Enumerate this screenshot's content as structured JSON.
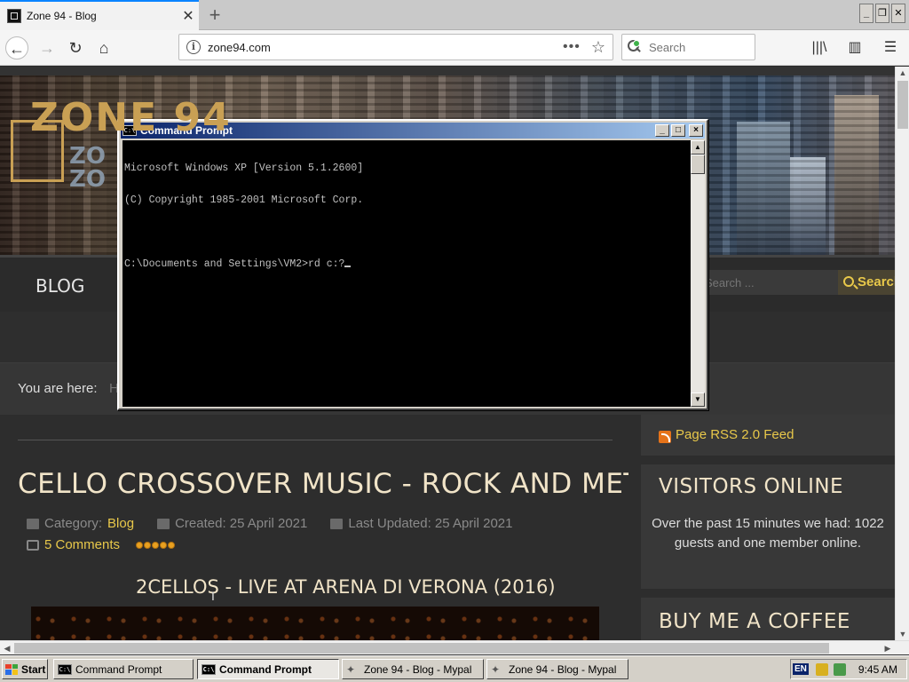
{
  "browser": {
    "tab_title": "Zone 94 - Blog",
    "tab_close": "✕",
    "new_tab": "+",
    "url": "zone94.com",
    "url_actions": "•••",
    "search_placeholder": "Search",
    "window_min": "_",
    "window_restore": "❐",
    "window_close": "✕"
  },
  "site": {
    "logo_text": "ZONE 94",
    "logo_ghost_1": "ZO",
    "logo_ghost_2": "ZO",
    "nav_blog": "BLOG",
    "search_placeholder": "Search ...",
    "search_button": "Search",
    "breadcrumb_label": "You are here:",
    "breadcrumb_home": "H"
  },
  "article": {
    "title": "CELLO CROSSOVER MUSIC - ROCK AND METAL",
    "category_label": "Category:",
    "category": "Blog",
    "created": "Created: 25 April 2021",
    "updated": "Last Updated: 25 April 2021",
    "comments": "5 Comments",
    "rating_stars": 5,
    "video_title": "2CELLOS - LIVE AT ARENA DI VERONA (2016)"
  },
  "sidebar": {
    "rss": "Page RSS 2.0 Feed",
    "visitors_title": "VISITORS ONLINE",
    "visitors_text": "Over the past 15 minutes we had: 1022 guests and one member online.",
    "coffee_title": "BUY ME A COFFEE"
  },
  "cmd": {
    "title": "Command Prompt",
    "icon_text": "C:\\",
    "lines": [
      "Microsoft Windows XP [Version 5.1.2600]",
      "(C) Copyright 1985-2001 Microsoft Corp."
    ],
    "prompt": "C:\\Documents and Settings\\VM2>rd c:?"
  },
  "taskbar": {
    "start": "Start",
    "tasks": [
      {
        "label": "Command Prompt",
        "type": "cmd",
        "active": false
      },
      {
        "label": "Command Prompt",
        "type": "cmd",
        "active": true
      },
      {
        "label": "Zone 94 - Blog - Mypal",
        "type": "browser",
        "active": false
      },
      {
        "label": "Zone 94 - Blog - Mypal",
        "type": "browser",
        "active": false
      }
    ],
    "lang": "EN",
    "time": "9:45 AM"
  }
}
